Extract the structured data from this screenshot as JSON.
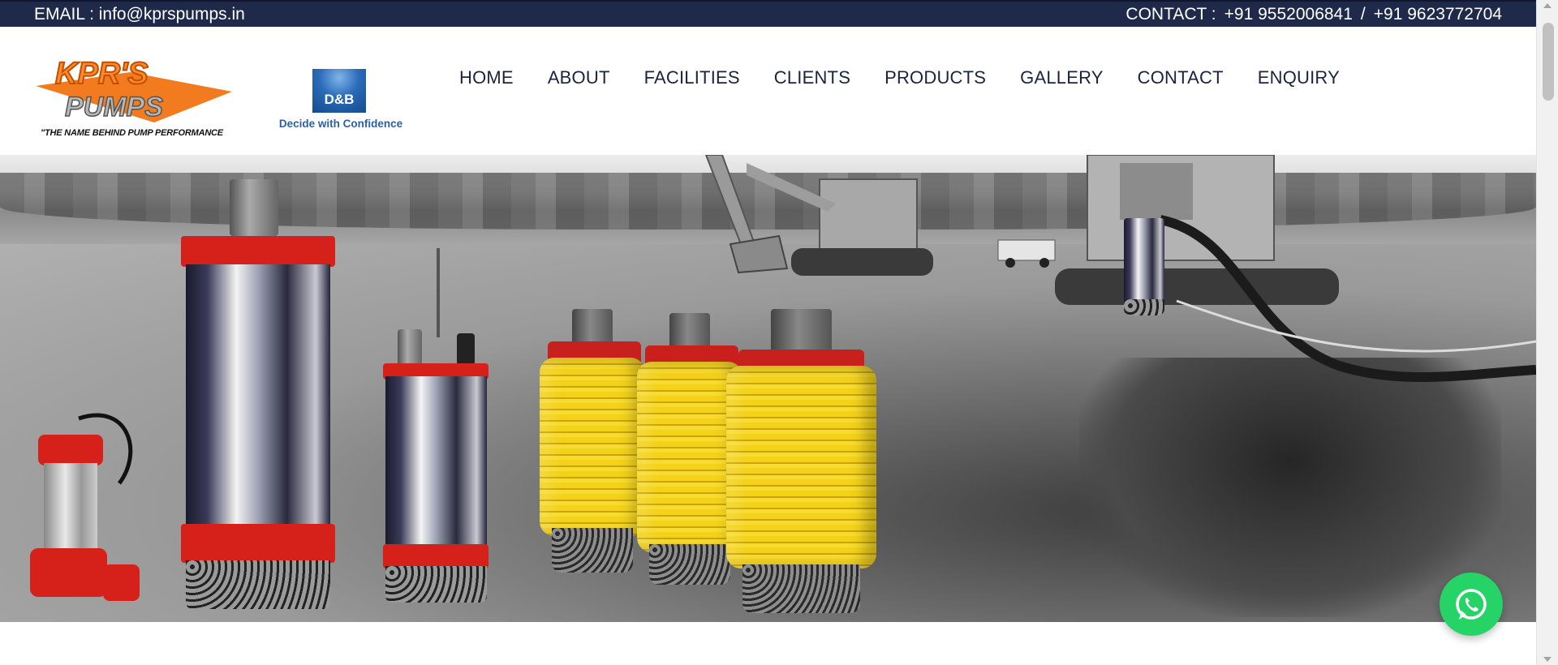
{
  "topbar": {
    "email": "EMAIL : info@kprspumps.in",
    "contact_label": "CONTACT :",
    "phone1": "+91 9552006841",
    "separator": "/",
    "phone2": "+91 9623772704"
  },
  "brand": {
    "name": "KPR'S PUMPS",
    "tagline": "\"THE NAME BEHIND PUMP PERFORMANCE"
  },
  "dnb": {
    "mark": "D&B",
    "caption": "Decide with Confidence"
  },
  "nav": {
    "items": [
      "HOME",
      "ABOUT",
      "FACILITIES",
      "CLIENTS",
      "PRODUCTS",
      "GALLERY",
      "CONTACT",
      "ENQUIRY"
    ]
  },
  "colors": {
    "topbar_bg": "#1f2a4a",
    "nav_text": "#1a2340",
    "pump_red": "#d6201a",
    "cable_yellow": "#f4d21a",
    "whatsapp_green": "#25d366",
    "logo_orange": "#f27b20"
  },
  "icons": {
    "whatsapp": "whatsapp-icon"
  }
}
